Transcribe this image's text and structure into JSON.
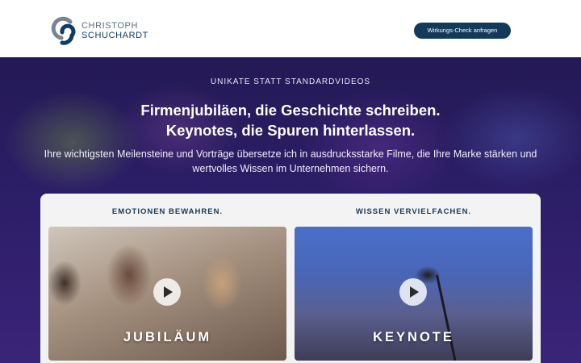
{
  "header": {
    "logo_line1": "CHRISTOPH",
    "logo_line2": "SCHUCHARDT",
    "cta_label": "Wirkungs-Check anfragen"
  },
  "hero": {
    "eyebrow": "UNIKATE STATT STANDARDVIDEOS",
    "headline_line1": "Firmenjubiläen, die Geschichte schreiben.",
    "headline_line2": "Keynotes, die Spuren hinterlassen.",
    "subtext": "Ihre wichtigsten Meilensteine und Vorträge übersetze ich in ausdrucksstarke Filme, die Ihre Marke stärken und wertvolles Wissen im Unternehmen sichern."
  },
  "columns": [
    {
      "title": "EMOTIONEN BEWAHREN.",
      "video_label": "JUBILÄUM"
    },
    {
      "title": "WISSEN VERVIELFACHEN.",
      "video_label": "KEYNOTE"
    }
  ],
  "colors": {
    "brand": "#123a5a",
    "hero_bg": "#2b1d66"
  }
}
